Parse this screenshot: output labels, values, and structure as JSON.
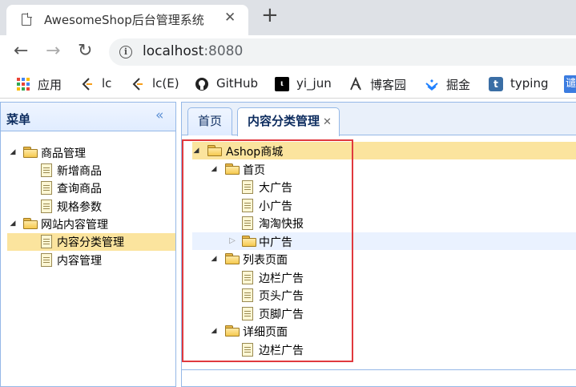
{
  "browser": {
    "tab_title": "AwesomeShop后台管理系统",
    "tab_close": "✕",
    "new_tab": "+",
    "back": "←",
    "forward": "→",
    "reload": "↻",
    "url_host": "localhost",
    "url_port": ":8080",
    "info_icon": "i",
    "bookmarks": [
      {
        "label": "应用",
        "icon": "apps-icon"
      },
      {
        "label": "lc",
        "icon": "lc-icon"
      },
      {
        "label": "lc(E)",
        "icon": "lc-icon"
      },
      {
        "label": "GitHub",
        "icon": "github-icon"
      },
      {
        "label": "yi_jun",
        "icon": "yi-icon"
      },
      {
        "label": "博客园",
        "icon": "cnblogs-icon"
      },
      {
        "label": "掘金",
        "icon": "juejin-icon"
      },
      {
        "label": "typing",
        "icon": "typing-icon"
      }
    ],
    "bookmark_more": "谴"
  },
  "west": {
    "title": "菜单",
    "collapse_icon": "«",
    "tree": [
      {
        "label": "商品管理",
        "type": "folder",
        "expanded": true
      },
      {
        "label": "新增商品",
        "type": "file"
      },
      {
        "label": "查询商品",
        "type": "file"
      },
      {
        "label": "规格参数",
        "type": "file"
      },
      {
        "label": "网站内容管理",
        "type": "folder",
        "expanded": true
      },
      {
        "label": "内容分类管理",
        "type": "file",
        "selected": true
      },
      {
        "label": "内容管理",
        "type": "file"
      }
    ]
  },
  "center": {
    "tabs": [
      {
        "label": "首页",
        "selected": false
      },
      {
        "label": "内容分类管理",
        "selected": true,
        "close": "✕"
      }
    ],
    "tree": [
      {
        "label": "Ashop商城",
        "type": "folder",
        "expanded": true,
        "selected": true
      },
      {
        "label": "首页",
        "type": "folder",
        "expanded": true
      },
      {
        "label": "大广告",
        "type": "file"
      },
      {
        "label": "小广告",
        "type": "file"
      },
      {
        "label": "淘淘快报",
        "type": "file"
      },
      {
        "label": "中广告",
        "type": "folder",
        "expanded": false
      },
      {
        "label": "列表页面",
        "type": "folder",
        "expanded": true
      },
      {
        "label": "边栏广告",
        "type": "file"
      },
      {
        "label": "页头广告",
        "type": "file"
      },
      {
        "label": "页脚广告",
        "type": "file"
      },
      {
        "label": "详细页面",
        "type": "folder",
        "expanded": true
      },
      {
        "label": "边栏广告",
        "type": "file"
      }
    ]
  },
  "colors": {
    "panel_border": "#95b8e7",
    "selected_row": "#fbe49e",
    "highlight_box": "#e0393e"
  }
}
